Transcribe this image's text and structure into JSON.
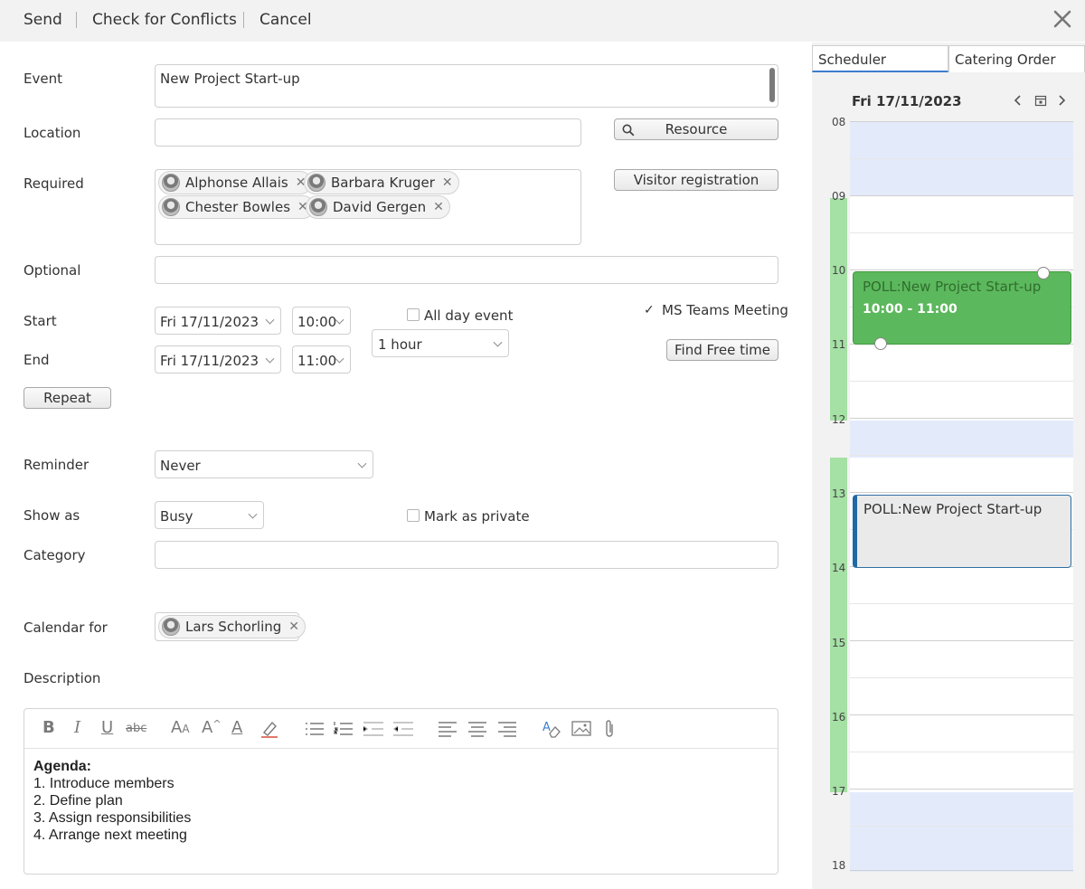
{
  "toolbar": {
    "send": "Send",
    "check_conflicts": "Check for Conflicts",
    "cancel": "Cancel"
  },
  "form": {
    "event_label": "Event",
    "event_value": "New Project Start-up",
    "location_label": "Location",
    "location_value": "",
    "resource_button": "Resource",
    "required_label": "Required",
    "required_attendees": [
      "Alphonse Allais",
      "Barbara Kruger",
      "Chester Bowles",
      "David Gergen"
    ],
    "visitor_button": "Visitor registration",
    "optional_label": "Optional",
    "start_label": "Start",
    "start_date": "Fri 17/11/2023",
    "start_time": "10:00",
    "end_label": "End",
    "end_date": "Fri 17/11/2023",
    "end_time": "11:00",
    "all_day_label": "All day event",
    "all_day_checked": false,
    "duration": "1 hour",
    "teams_label": "MS Teams Meeting",
    "teams_checked": true,
    "find_free_button": "Find Free time",
    "repeat_button": "Repeat",
    "reminder_label": "Reminder",
    "reminder_value": "Never",
    "show_as_label": "Show as",
    "show_as_value": "Busy",
    "private_label": "Mark as private",
    "private_checked": false,
    "category_label": "Category",
    "calendar_for_label": "Calendar for",
    "calendar_for_person": "Lars Schorling",
    "description_label": "Description"
  },
  "editor": {
    "tools": [
      "bold-icon",
      "italic-icon",
      "underline-icon",
      "strikethrough-icon",
      "font-family-icon",
      "font-size-icon",
      "font-color-icon",
      "highlight-icon",
      "bulleted-list-icon",
      "numbered-list-icon",
      "indent-icon",
      "outdent-icon",
      "align-left-icon",
      "align-center-icon",
      "align-right-icon",
      "clear-format-icon",
      "insert-image-icon",
      "attach-icon"
    ],
    "heading": "Agenda:",
    "lines": [
      "1. Introduce members",
      "2. Define plan",
      "3. Assign responsibilities",
      "4. Arrange next meeting"
    ]
  },
  "panel": {
    "tabs": [
      "Scheduler",
      "Catering Order"
    ],
    "active_tab": "Scheduler",
    "date": "Fri 17/11/2023",
    "hours": [
      "08",
      "09",
      "10",
      "11",
      "12",
      "13",
      "14",
      "15",
      "16",
      "17",
      "18"
    ],
    "appointment_1_title": "POLL:New Project Start-up",
    "appointment_1_time": "10:00 - 11:00",
    "appointment_2_title": "POLL:New Project Start-up"
  },
  "colors": {
    "appointment_green": "#5cb85c",
    "busy_bar": "#a5e0a5",
    "off_hours": "#e3ebfb",
    "appointment_border_blue": "#1f6aa5"
  }
}
